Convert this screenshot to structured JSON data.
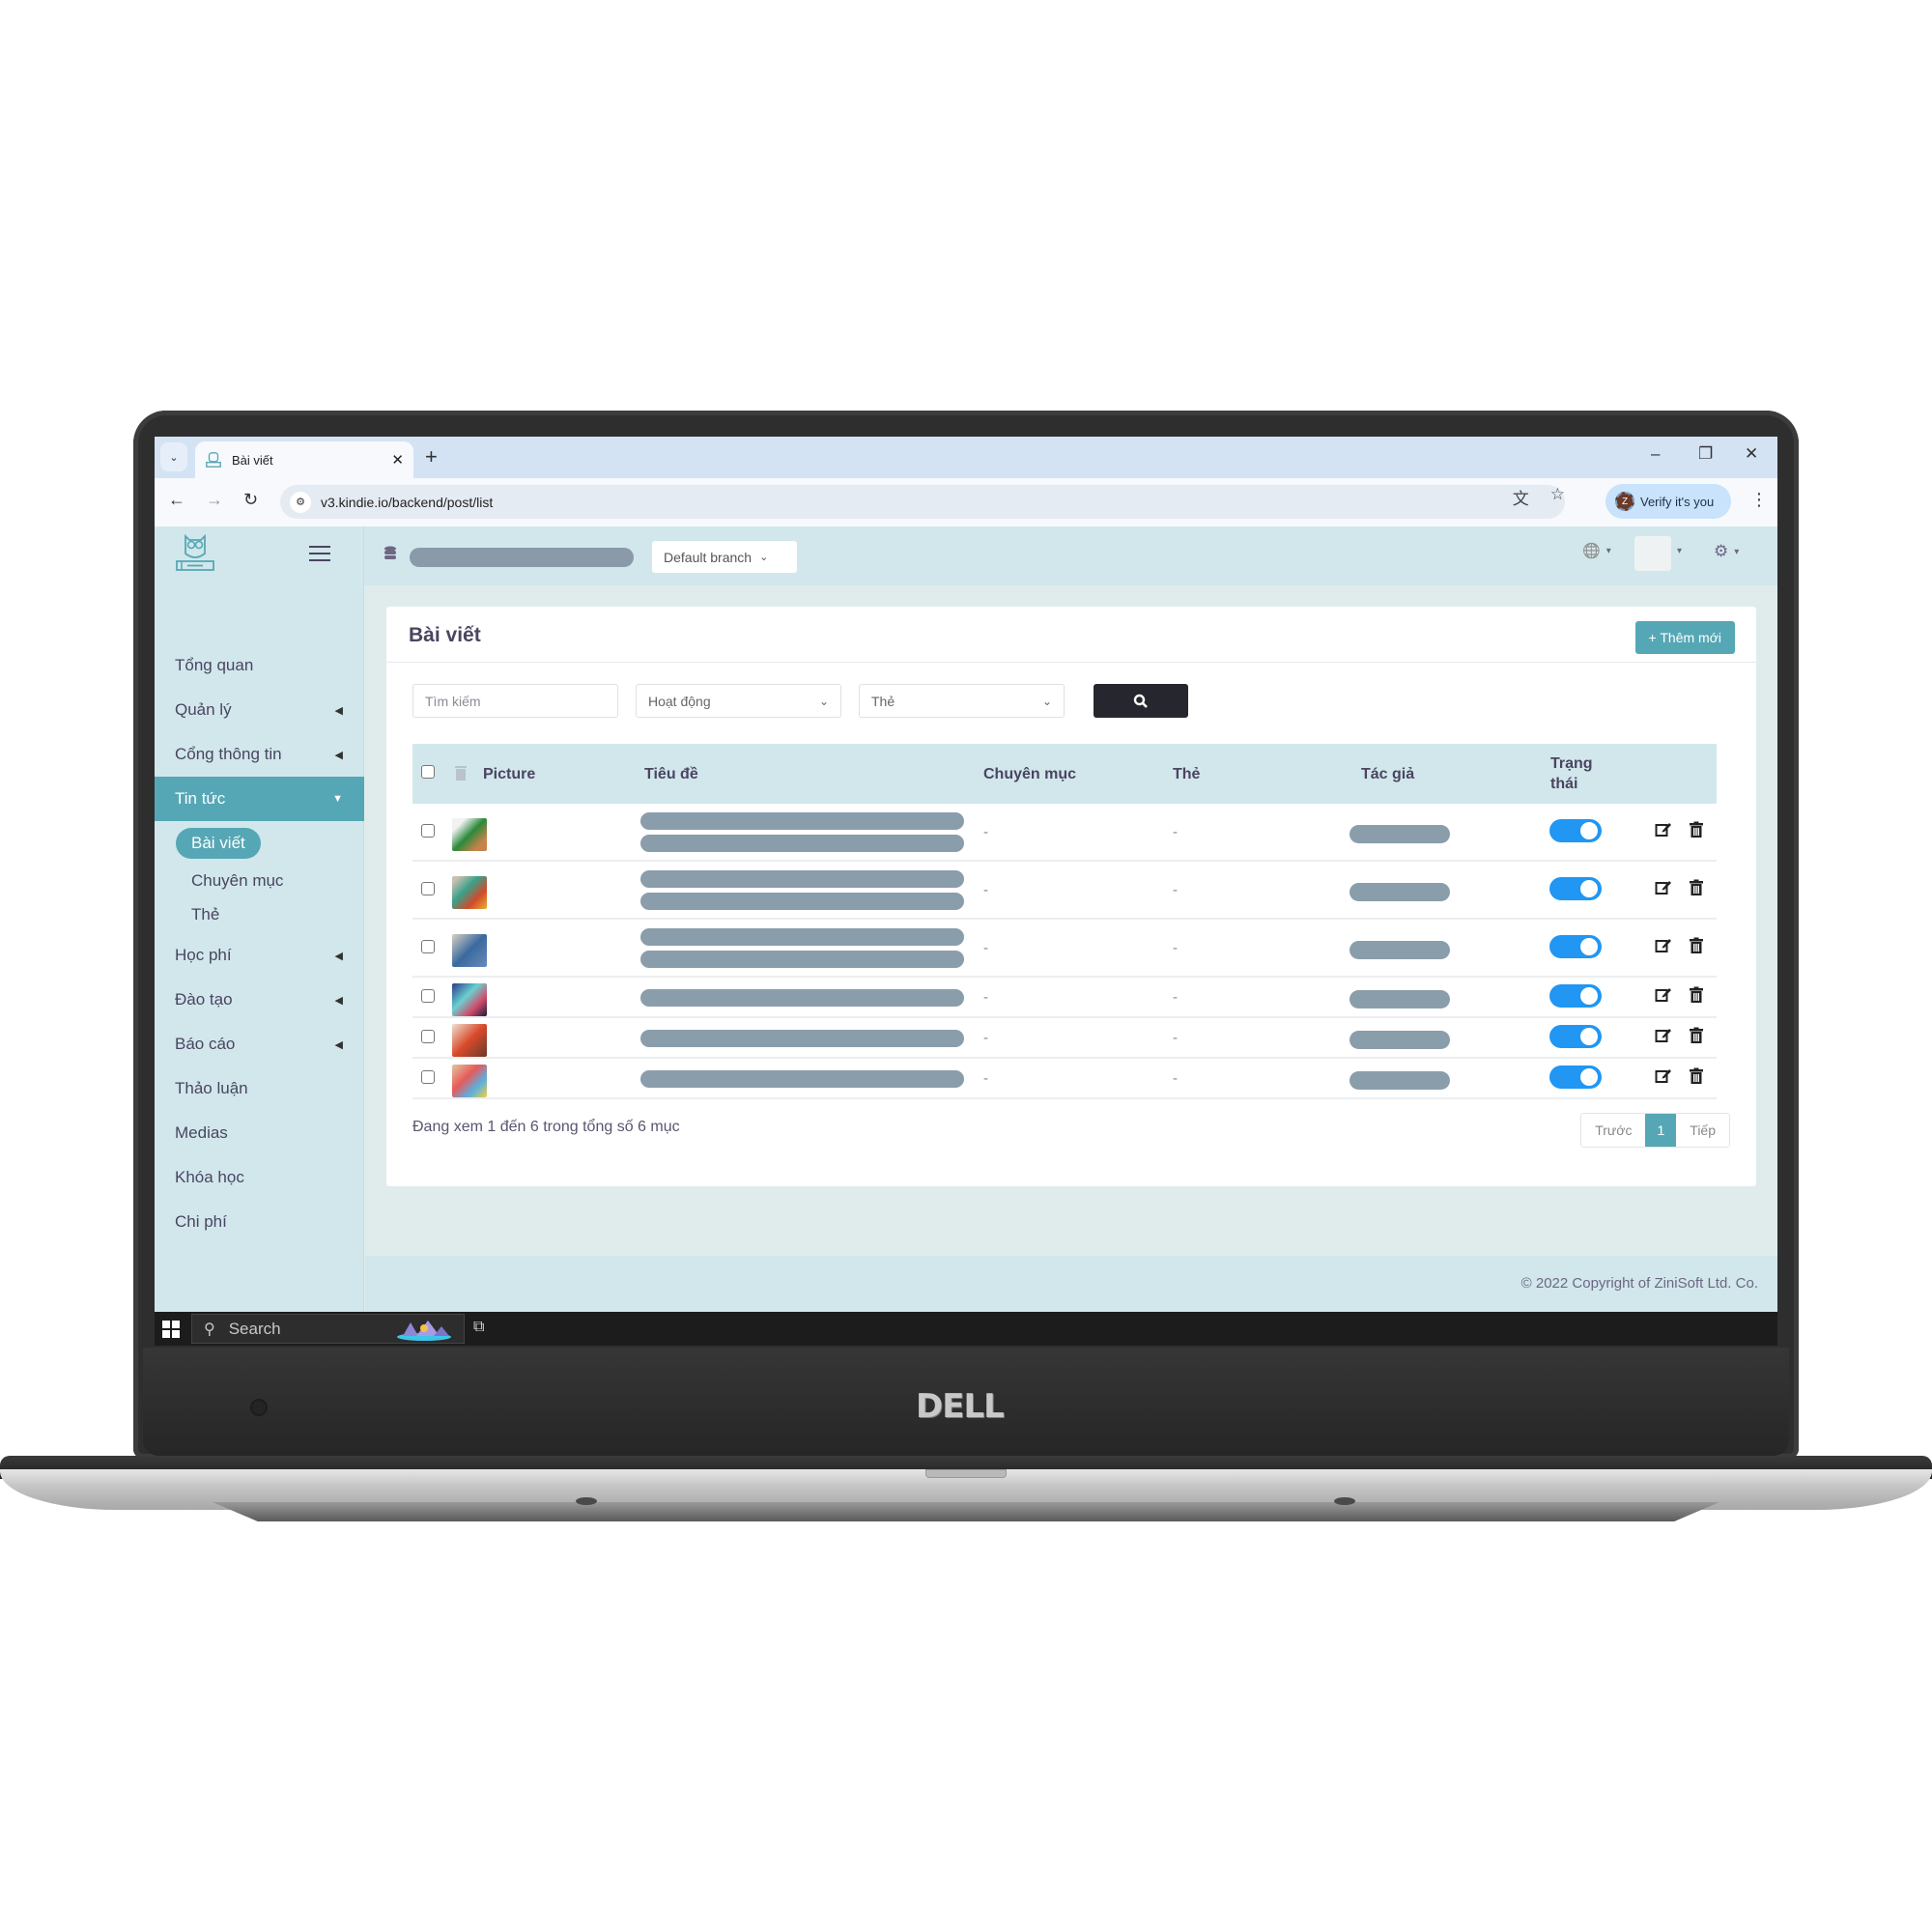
{
  "browser": {
    "tab_title": "Bài viết",
    "url": "v3.kindie.io/backend/post/list",
    "verify_label": "Verify it's you",
    "profile_initial": "Z",
    "new_tab": "+",
    "tab_close": "✕",
    "minimize": "–",
    "restore": "❐",
    "close": "✕",
    "back": "←",
    "forward": "→",
    "reload": "↻",
    "translate_icon": "⽂",
    "star_icon": "☆",
    "menu_icon": "⋮",
    "tab_list_icon": "⌄"
  },
  "header": {
    "branch_select": "Default branch",
    "globe_icon": "🌐",
    "gear_icon": "⚙",
    "caret": "▾"
  },
  "sidebar": {
    "items": [
      {
        "label": "Tổng quan",
        "arrow": ""
      },
      {
        "label": "Quản lý",
        "arrow": "◀"
      },
      {
        "label": "Cổng thông tin",
        "arrow": "◀"
      },
      {
        "label": "Tin tức",
        "arrow": "▼",
        "active": true
      },
      {
        "label": "Học phí",
        "arrow": "◀"
      },
      {
        "label": "Đào tạo",
        "arrow": "◀"
      },
      {
        "label": "Báo cáo",
        "arrow": "◀"
      },
      {
        "label": "Thảo luận",
        "arrow": ""
      },
      {
        "label": "Medias",
        "arrow": ""
      },
      {
        "label": "Khóa học",
        "arrow": ""
      },
      {
        "label": "Chi phí",
        "arrow": ""
      }
    ],
    "subitems": [
      {
        "label": "Bài viết",
        "active": true
      },
      {
        "label": "Chuyên mục"
      },
      {
        "label": "Thẻ"
      }
    ]
  },
  "page": {
    "title": "Bài viết",
    "add_button": "+ Thêm mới",
    "search_placeholder": "Tìm kiếm",
    "status_filter": "Hoạt động",
    "tag_filter": "Thẻ",
    "search_icon": "⌕",
    "columns": [
      "Picture",
      "Tiêu đề",
      "Chuyên mục",
      "Thẻ",
      "Tác giả",
      "Trạng thái"
    ],
    "rows": [
      {
        "title_lines": 2,
        "category": "-",
        "tag": "-",
        "active": true
      },
      {
        "title_lines": 2,
        "category": "-",
        "tag": "-",
        "active": true
      },
      {
        "title_lines": 2,
        "category": "-",
        "tag": "-",
        "active": true
      },
      {
        "title_lines": 1,
        "category": "-",
        "tag": "-",
        "active": true
      },
      {
        "title_lines": 1,
        "category": "-",
        "tag": "-",
        "active": true
      },
      {
        "title_lines": 1,
        "category": "-",
        "tag": "-",
        "active": true
      }
    ],
    "info": "Đang xem 1 đến 6 trong tổng số 6 mục",
    "pagination": {
      "prev": "Trước",
      "current": "1",
      "next": "Tiếp"
    }
  },
  "footer": {
    "copyright": "© 2022 Copyright of ZiniSoft Ltd. Co."
  },
  "taskbar": {
    "search_label": "Search"
  },
  "laptop": {
    "brand": "DELL"
  },
  "colors": {
    "accent": "#56a7b5",
    "toggle_on": "#2196f3",
    "sidebar_bg": "#d1e7ec",
    "content_bg": "#dfeceb",
    "redacted": "#8a9dab",
    "search_btn": "#26272e"
  }
}
